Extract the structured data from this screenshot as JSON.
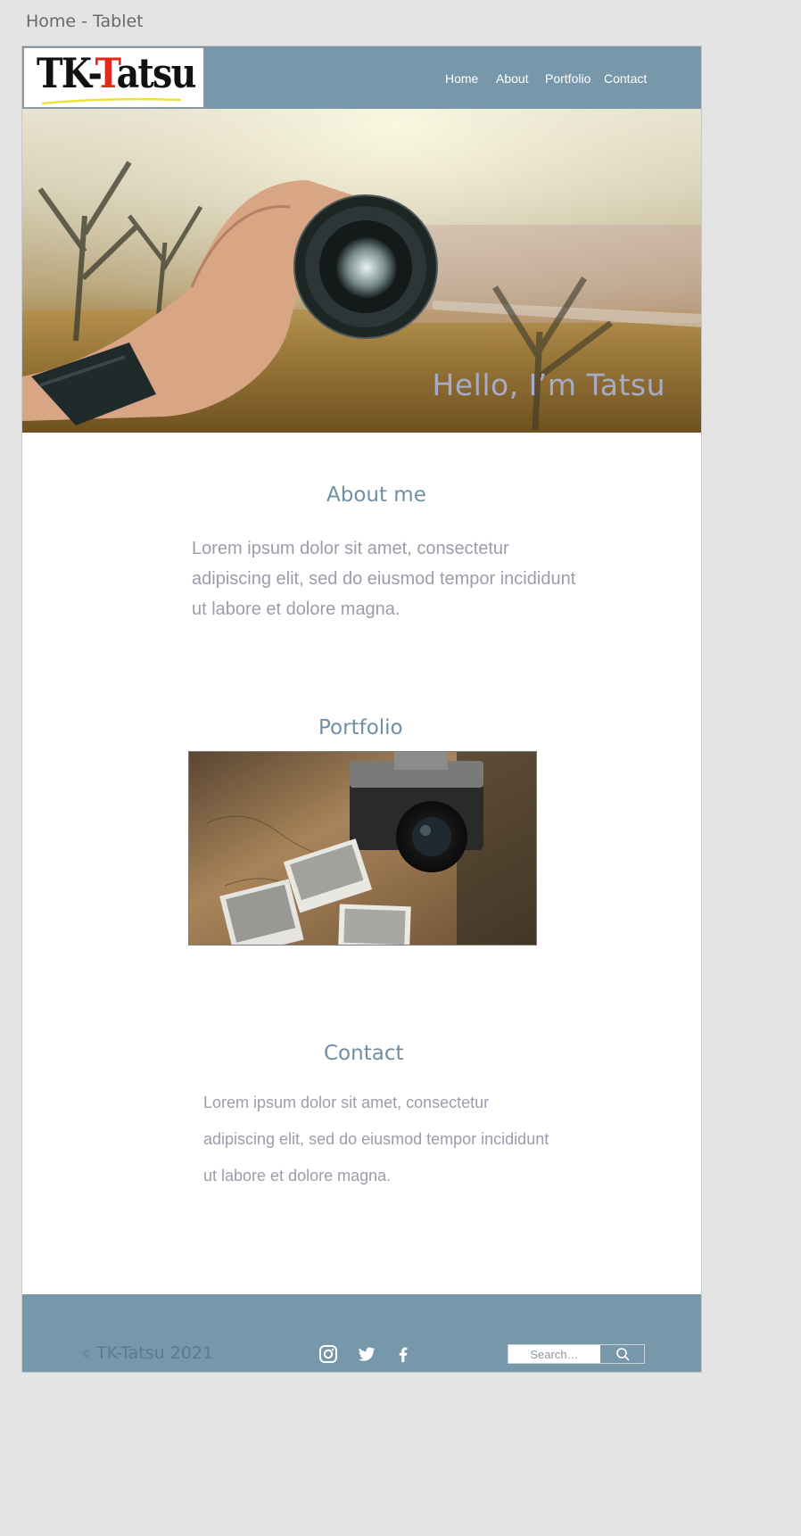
{
  "frame": {
    "label": "Home - Tablet"
  },
  "header": {
    "logo": {
      "text_main": "TK-",
      "text_red": "T",
      "text_rest": "atsu"
    },
    "nav": [
      {
        "label": "Home"
      },
      {
        "label": "About"
      },
      {
        "label": "Portfolio"
      },
      {
        "label": "Contact"
      }
    ]
  },
  "hero": {
    "title": "Hello, I’m Tatsu"
  },
  "about": {
    "title": "About me",
    "text": "Lorem ipsum dolor sit amet, consectetur adipiscing elit, sed do eiusmod tempor incididunt ut labore et dolore magna."
  },
  "portfolio": {
    "title": "Portfolio"
  },
  "contact": {
    "title": "Contact",
    "text": "Lorem ipsum dolor sit amet, consectetur adipiscing elit, sed do eiusmod tempor incididunt ut labore et dolore magna."
  },
  "footer": {
    "copyright_symbol": "©",
    "copyright": "TK-Tatsu 2021",
    "social_icons": [
      "instagram-icon",
      "twitter-icon",
      "facebook-icon"
    ],
    "search": {
      "placeholder": "Search…"
    }
  },
  "colors": {
    "accent": "#7797ab",
    "heading": "#6f8fa4",
    "body_text": "#9c9cab",
    "hero_title": "#a6acc7",
    "logo_red": "#e12a1a"
  }
}
